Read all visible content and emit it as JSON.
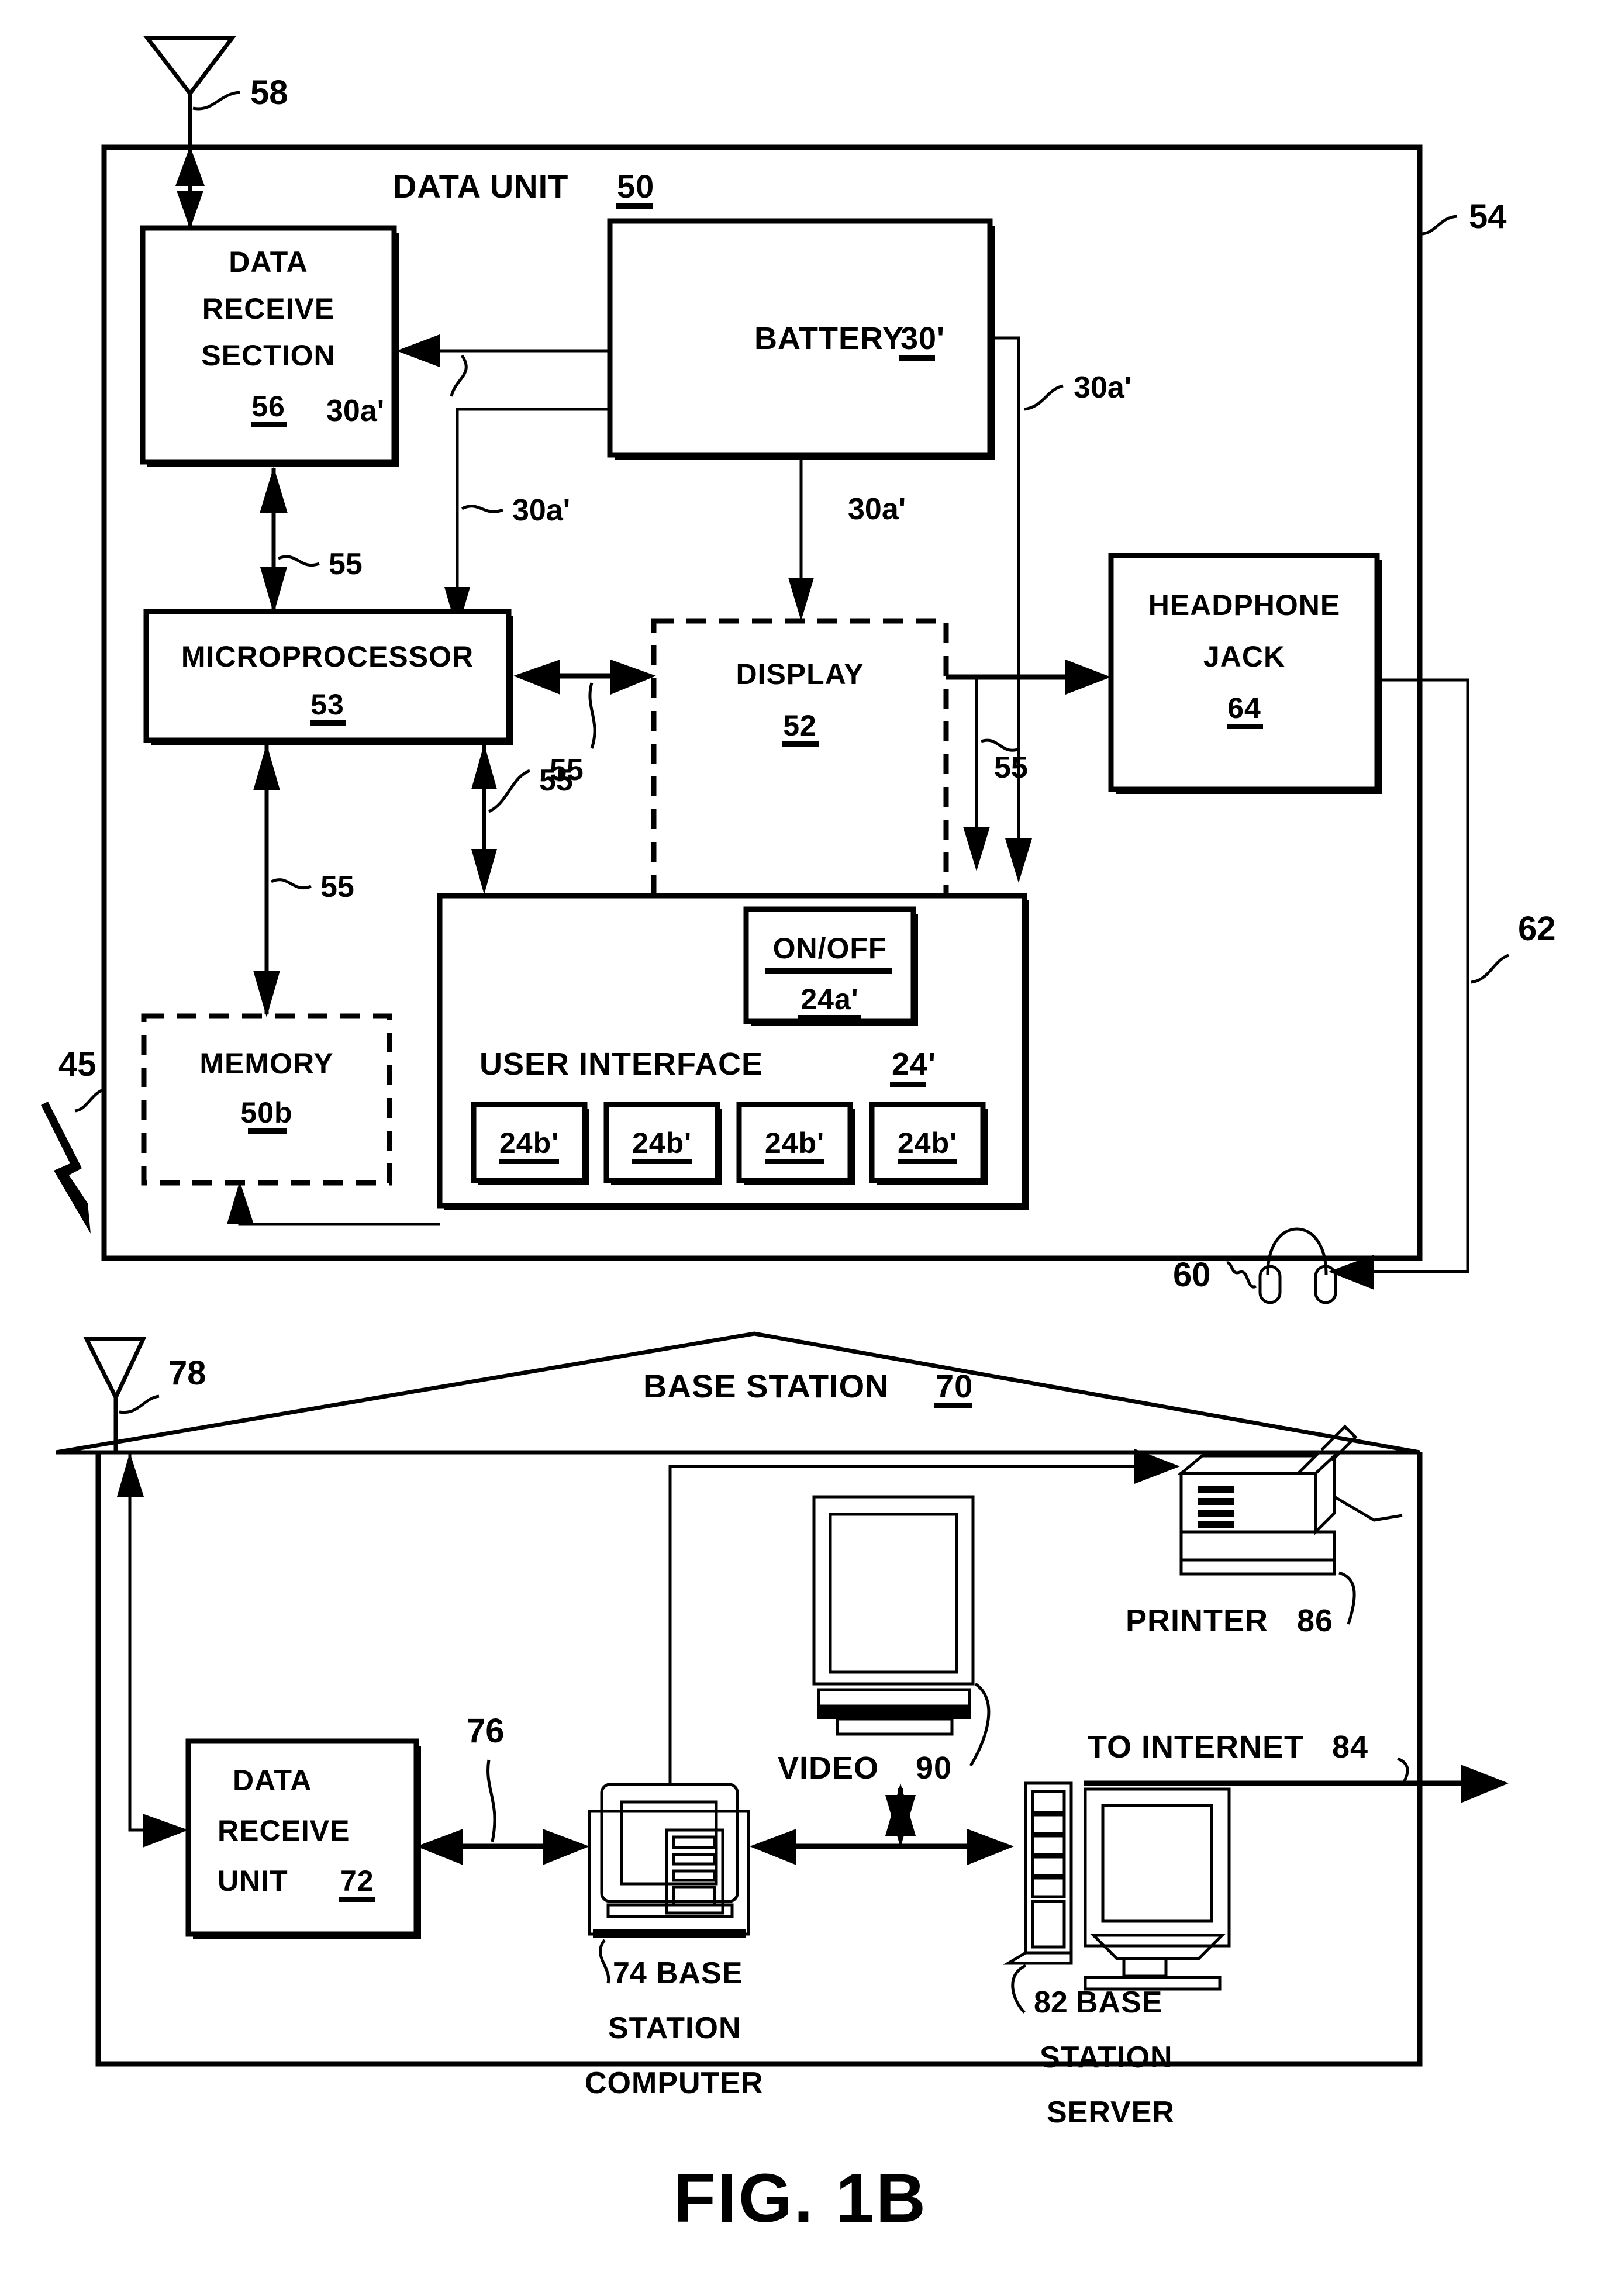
{
  "figure": {
    "caption": "FIG. 1B"
  },
  "data_unit": {
    "title": "DATA UNIT",
    "title_ref": "50",
    "enclosure_ref": "54",
    "system_ref": "45",
    "antenna_ref": "58",
    "blocks": {
      "data_receive_section": {
        "line1": "DATA",
        "line2": "RECEIVE",
        "line3": "SECTION",
        "ref": "56"
      },
      "battery": {
        "label": "BATTERY",
        "ref": "30'"
      },
      "microprocessor": {
        "label": "MICROPROCESSOR",
        "ref": "53"
      },
      "display": {
        "label": "DISPLAY",
        "ref": "52"
      },
      "memory": {
        "label": "MEMORY",
        "ref": "50b"
      },
      "headphone_jack": {
        "line1": "HEADPHONE",
        "line2": "JACK",
        "ref": "64"
      },
      "user_interface": {
        "label": "USER  INTERFACE",
        "ref": "24'",
        "on_off": {
          "label": "ON/OFF",
          "ref": "24a'"
        },
        "buttons": [
          {
            "ref": "24b'"
          },
          {
            "ref": "24b'"
          },
          {
            "ref": "24b'"
          },
          {
            "ref": "24b'"
          }
        ]
      }
    },
    "bus_labels": {
      "power": "30a'",
      "signal": "55"
    },
    "power_labels": [
      "30a'",
      "30a'",
      "30a'",
      "30a'"
    ],
    "signal_labels": [
      "55",
      "55",
      "55",
      "55"
    ],
    "headphones": {
      "name": "headphones",
      "ref": "60"
    },
    "headphone_cable_ref": "62"
  },
  "base_station": {
    "title": "BASE STATION",
    "title_ref": "70",
    "antenna_ref": "78",
    "blocks": {
      "data_receive_unit": {
        "line1": "DATA",
        "line2": "RECEIVE",
        "line3": "UNIT",
        "ref": "72"
      },
      "base_station_computer": {
        "ref": "74",
        "line1": "BASE",
        "line2": "STATION",
        "line3": "COMPUTER"
      },
      "base_station_server": {
        "ref": "82",
        "line1": "BASE",
        "line2": "STATION",
        "line3": "SERVER"
      },
      "printer": {
        "label": "PRINTER",
        "ref": "86"
      },
      "video": {
        "label": "VIDEO",
        "ref": "90"
      }
    },
    "link_ref": "76",
    "internet": {
      "label": "TO INTERNET",
      "ref": "84"
    }
  }
}
